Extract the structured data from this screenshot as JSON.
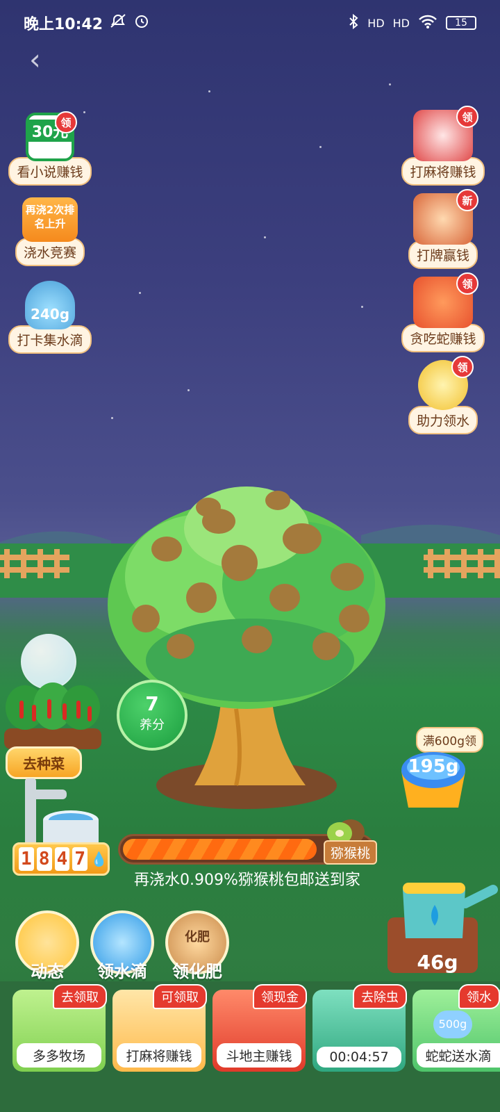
{
  "status_bar": {
    "time": "晚上10:42",
    "battery": "15",
    "hd1": "HD",
    "hd2": "HD"
  },
  "left_tasks": [
    {
      "label": "看小说赚钱",
      "badge": "领",
      "pic_text": "30元"
    },
    {
      "label": "浇水竞赛",
      "pic_text": "再浇2次排名上升"
    },
    {
      "label": "打卡集水滴",
      "pic_text": "240g"
    }
  ],
  "right_tasks": [
    {
      "label": "打麻将赚钱",
      "badge": "领"
    },
    {
      "label": "打牌赢钱",
      "badge": "新"
    },
    {
      "label": "贪吃蛇赚钱",
      "badge": "领"
    },
    {
      "label": "助力领水",
      "badge": "领"
    }
  ],
  "nutrient": {
    "value": "7",
    "label": "养分"
  },
  "plant_button": "去种菜",
  "water_counter": {
    "digits": [
      "1",
      "8",
      "4",
      "7"
    ]
  },
  "water_box": {
    "tag": "满600g领",
    "amount": "195g"
  },
  "progress": {
    "percent": 0.78,
    "fruit": "猕猴桃",
    "text": "再浇水0.909%猕猴桃包邮送到家"
  },
  "watering_can": {
    "amount": "46g"
  },
  "circle_buttons": [
    {
      "label": "动态"
    },
    {
      "label": "领水滴"
    },
    {
      "label": "领化肥",
      "pic_text": "化肥"
    }
  ],
  "games": [
    {
      "tag": "去领取",
      "label": "多多牧场"
    },
    {
      "tag": "可领取",
      "label": "打麻将赚钱"
    },
    {
      "tag": "领现金",
      "label": "斗地主赚钱"
    },
    {
      "tag": "去除虫",
      "label": "00:04:57"
    },
    {
      "tag": "领水",
      "label": "蛇蛇送水滴",
      "pic_text": "500g"
    }
  ],
  "colors": {
    "accent_orange": "#f7a524",
    "badge_red": "#e63939",
    "grass_green": "#2d8a46",
    "night_sky": "#2f3470"
  },
  "icons": [
    "back-arrow-icon",
    "bluetooth-icon",
    "wifi-icon",
    "alarm-icon",
    "mute-icon",
    "battery-icon"
  ]
}
